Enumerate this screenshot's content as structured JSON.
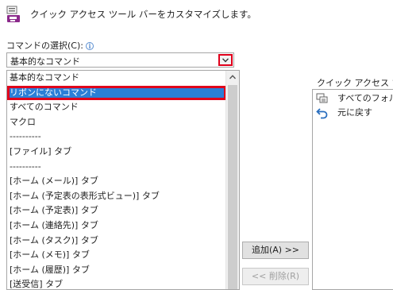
{
  "header": {
    "text": "クイック アクセス ツール バーをカスタマイズします。"
  },
  "command_select": {
    "label": "コマンドの選択(C):",
    "info_icon": "info-icon",
    "current_value": "基本的なコマンド"
  },
  "dropdown": {
    "items": [
      {
        "label": "基本的なコマンド"
      },
      {
        "label": "リボンにないコマンド"
      },
      {
        "label": "すべてのコマンド"
      },
      {
        "label": "マクロ"
      },
      {
        "label": "----------"
      },
      {
        "label": "[ファイル] タブ"
      },
      {
        "label": "----------"
      },
      {
        "label": "[ホーム (メール)] タブ"
      },
      {
        "label": "[ホーム (予定表の表形式ビュー)] タブ"
      },
      {
        "label": "[ホーム (予定表)] タブ"
      },
      {
        "label": "[ホーム (連絡先)] タブ"
      },
      {
        "label": "[ホーム (タスク)] タブ"
      },
      {
        "label": "[ホーム (メモ)] タブ"
      },
      {
        "label": "[ホーム (履歴)] タブ"
      },
      {
        "label": "[送受信] タブ"
      }
    ],
    "selected_index": 1
  },
  "buttons": {
    "add_label": "追加(A) >>",
    "remove_label": "<< 削除(R)"
  },
  "qat": {
    "label": "クイック アクセス ツー",
    "items": [
      {
        "label": "すべてのフォルダ",
        "icon": "send-receive-icon"
      },
      {
        "label": "元に戻す",
        "icon": "undo-icon"
      }
    ]
  },
  "colors": {
    "highlight_border": "#e0001b",
    "selection": "#2b7fd6"
  }
}
